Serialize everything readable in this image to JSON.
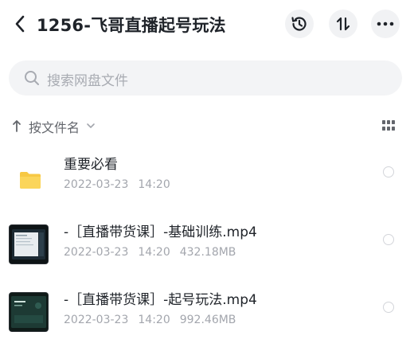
{
  "header": {
    "title": "1256-飞哥直播起号玩法",
    "back_icon": "chevron-left-icon",
    "history_icon": "history-clock-icon",
    "sort_icon": "sort-arrows-icon",
    "more_icon": "more-dots-icon"
  },
  "search": {
    "placeholder": "搜索网盘文件"
  },
  "sortbar": {
    "label": "按文件名",
    "view_icon": "grid-view-icon"
  },
  "files": [
    {
      "name": "重要必看",
      "date": "2022-03-23",
      "time": "14:20",
      "size": "",
      "type": "folder",
      "icon": "folder-icon"
    },
    {
      "name": "-［直播带货课］-基础训练.mp4",
      "date": "2022-03-23",
      "time": "14:20",
      "size": "432.18MB",
      "type": "video",
      "icon": "video-thumbnail"
    },
    {
      "name": "-［直播带货课］-起号玩法.mp4",
      "date": "2022-03-23",
      "time": "14:20",
      "size": "992.46MB",
      "type": "video",
      "icon": "video-thumbnail"
    }
  ],
  "colors": {
    "folder": "#f7c844",
    "accent_text": "#1f2329",
    "muted_text": "#a3a6ad"
  }
}
